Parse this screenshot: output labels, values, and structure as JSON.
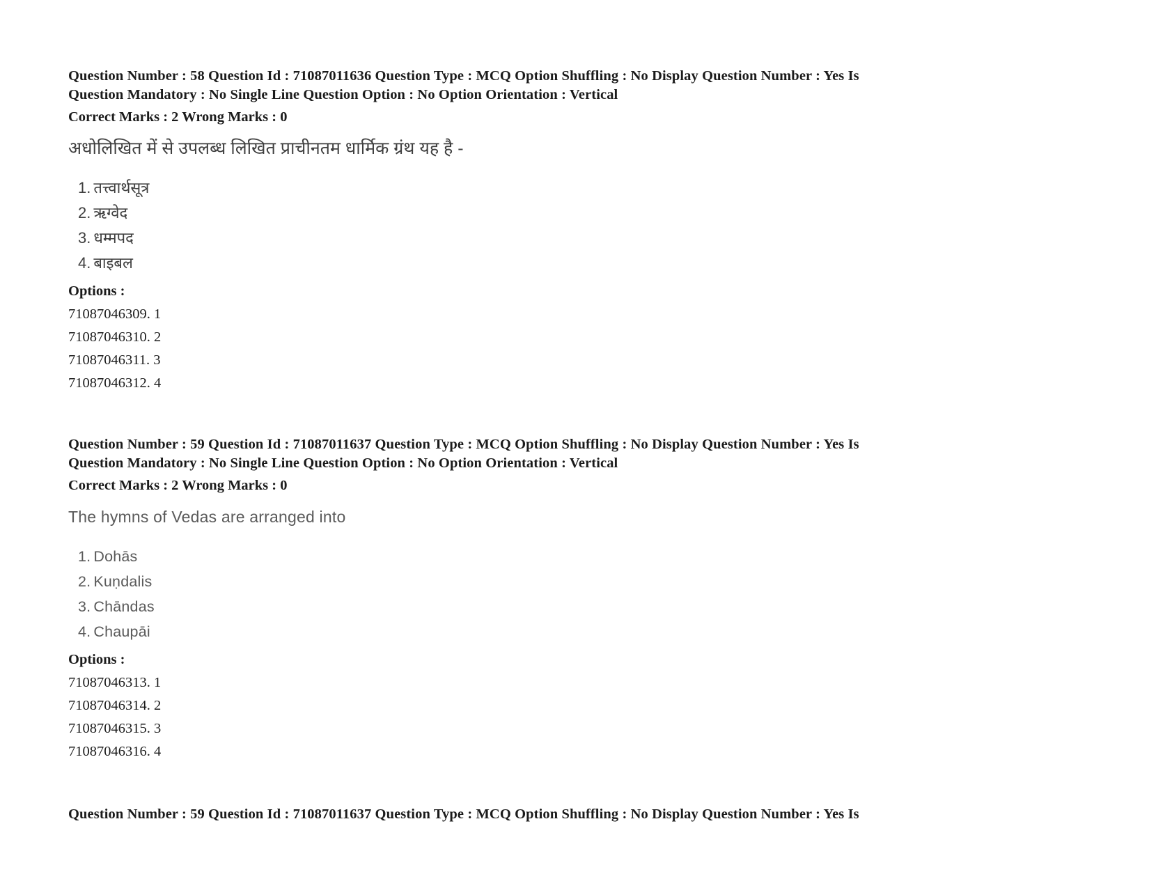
{
  "document": {
    "type": "exam-question-paper",
    "background_color": "#ffffff",
    "text_color": "#1b1b1b",
    "secondary_text_color": "#4a4a4a"
  },
  "questions": [
    {
      "meta_line_1": "Question Number : 58 Question Id : 71087011636 Question Type : MCQ Option Shuffling : No Display Question Number : Yes Is",
      "meta_line_2": "Question Mandatory : No Single Line Question Option : No Option Orientation : Vertical",
      "marks_line": "Correct Marks : 2 Wrong Marks : 0",
      "stem": "अधोलिखित में से उपलब्ध लिखित प्राचीनतम धार्मिक ग्रंथ यह है -",
      "script": "devanagari",
      "choices": [
        {
          "num": "1.",
          "text": "तत्त्वार्थसूत्र"
        },
        {
          "num": "2.",
          "text": "ऋग्वेद"
        },
        {
          "num": "3.",
          "text": "धम्मपद"
        },
        {
          "num": "4.",
          "text": "बाइबल"
        }
      ],
      "options_label": "Options :",
      "option_ids": [
        "71087046309. 1",
        "71087046310. 2",
        "71087046311. 3",
        "71087046312. 4"
      ]
    },
    {
      "meta_line_1": "Question Number : 59 Question Id : 71087011637 Question Type : MCQ Option Shuffling : No Display Question Number : Yes Is",
      "meta_line_2": "Question Mandatory : No Single Line Question Option : No Option Orientation : Vertical",
      "marks_line": "Correct Marks : 2 Wrong Marks : 0",
      "stem": "The hymns of Vedas are arranged into",
      "script": "latin",
      "choices": [
        {
          "num": "1.",
          "text": "Dohās"
        },
        {
          "num": "2.",
          "text": "Kuṇdalis"
        },
        {
          "num": "3.",
          "text": "Chāndas"
        },
        {
          "num": "4.",
          "text": "Chaupāi"
        }
      ],
      "options_label": "Options :",
      "option_ids": [
        "71087046313. 1",
        "71087046314. 2",
        "71087046315. 3",
        "71087046316. 4"
      ]
    }
  ],
  "trailing": {
    "meta_line_1": "Question Number : 59 Question Id : 71087011637 Question Type : MCQ Option Shuffling : No Display Question Number : Yes Is"
  }
}
